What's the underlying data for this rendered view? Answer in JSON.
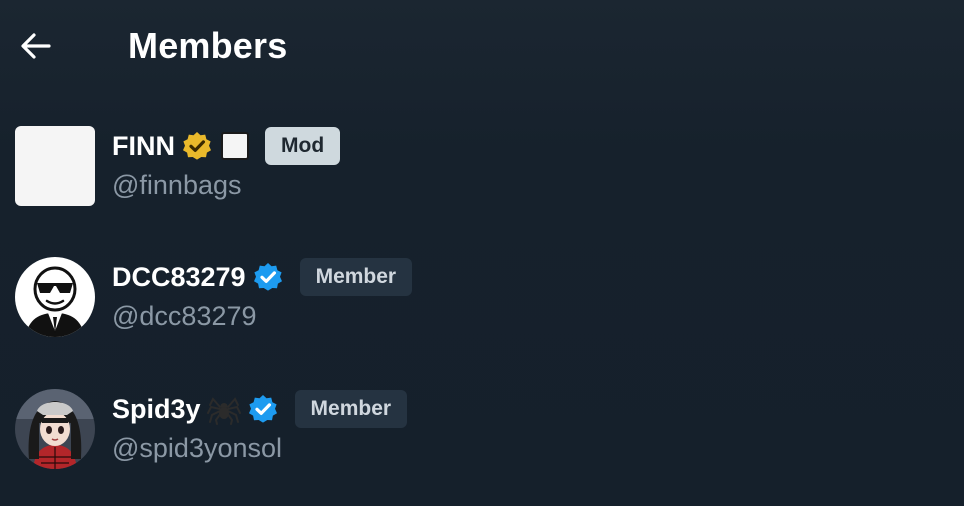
{
  "header": {
    "back_label": "←",
    "title": "Members"
  },
  "members": [
    {
      "display_name": "FINN",
      "handle": "@finnbags",
      "verified_badge": "gold-verified-icon",
      "emoji": "white-square-emoji",
      "role": "Mod",
      "avatar": "blank-square-avatar"
    },
    {
      "display_name": "DCC83279",
      "handle": "@dcc83279",
      "verified_badge": "blue-verified-icon",
      "role": "Member",
      "avatar": "sunglasses-man-avatar"
    },
    {
      "display_name": "Spid3y",
      "handle": "@spid3yonsol",
      "verified_badge": "blue-verified-icon",
      "emoji": "spider-emoji",
      "role": "Member",
      "avatar": "anime-girl-avatar"
    }
  ],
  "colors": {
    "background": "#15202b",
    "gold_badge": "#e9b92b",
    "blue_badge": "#1d9bf0",
    "handle_text": "#8b98a5",
    "mod_pill": "#cfd9de",
    "member_pill": "#253341"
  }
}
